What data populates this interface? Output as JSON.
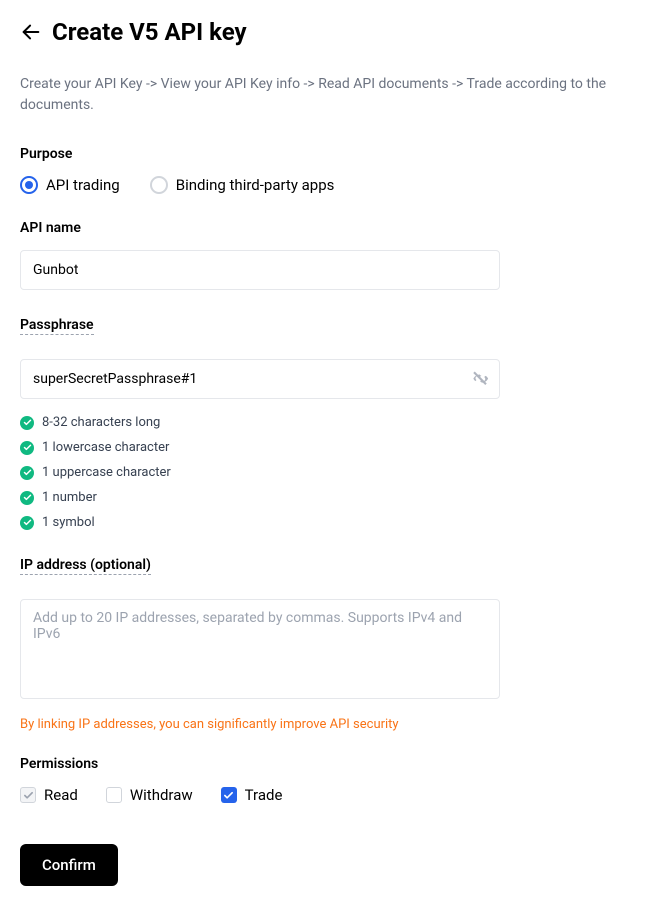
{
  "header": {
    "title": "Create V5 API key",
    "subtitle": "Create your API Key -> View your API Key info -> Read API documents -> Trade according to the documents."
  },
  "purpose": {
    "label": "Purpose",
    "options": [
      {
        "label": "API trading",
        "selected": true
      },
      {
        "label": "Binding third-party apps",
        "selected": false
      }
    ]
  },
  "apiName": {
    "label": "API name",
    "value": "Gunbot"
  },
  "passphrase": {
    "label": "Passphrase",
    "value": "superSecretPassphrase#1",
    "rules": [
      "8-32 characters long",
      "1 lowercase character",
      "1 uppercase character",
      "1 number",
      "1 symbol"
    ]
  },
  "ip": {
    "label": "IP address (optional)",
    "placeholder": "Add up to 20 IP addresses, separated by commas. Supports IPv4 and IPv6",
    "value": "",
    "note": "By linking IP addresses, you can significantly improve API security"
  },
  "permissions": {
    "label": "Permissions",
    "items": [
      {
        "label": "Read",
        "state": "disabled-checked"
      },
      {
        "label": "Withdraw",
        "state": "unchecked"
      },
      {
        "label": "Trade",
        "state": "checked"
      }
    ]
  },
  "confirm": {
    "label": "Confirm"
  }
}
